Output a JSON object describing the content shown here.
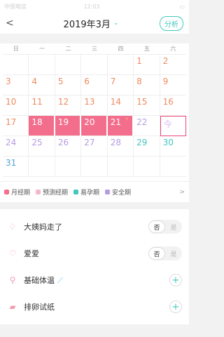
{
  "status": {
    "carrier": "中国电信",
    "time": "12:03"
  },
  "header": {
    "back_symbol": "<",
    "title": "2019年3月",
    "dropdown_symbol": "⌄",
    "analyze_label": "分析"
  },
  "weekdays": [
    "日",
    "一",
    "二",
    "三",
    "四",
    "五",
    "六"
  ],
  "calendar": {
    "cells": [
      {
        "day": "",
        "type": "empty"
      },
      {
        "day": "",
        "type": "empty"
      },
      {
        "day": "",
        "type": "empty"
      },
      {
        "day": "",
        "type": "empty"
      },
      {
        "day": "",
        "type": "empty"
      },
      {
        "day": "1",
        "type": "orange"
      },
      {
        "day": "2",
        "type": "orange"
      },
      {
        "day": "3",
        "type": "orange"
      },
      {
        "day": "4",
        "type": "orange"
      },
      {
        "day": "5",
        "type": "orange"
      },
      {
        "day": "6",
        "type": "orange"
      },
      {
        "day": "7",
        "type": "orange"
      },
      {
        "day": "8",
        "type": "orange"
      },
      {
        "day": "9",
        "type": "orange"
      },
      {
        "day": "10",
        "type": "orange"
      },
      {
        "day": "11",
        "type": "orange"
      },
      {
        "day": "12",
        "type": "orange"
      },
      {
        "day": "13",
        "type": "orange"
      },
      {
        "day": "14",
        "type": "orange"
      },
      {
        "day": "15",
        "type": "orange"
      },
      {
        "day": "16",
        "type": "orange"
      },
      {
        "day": "17",
        "type": "orange"
      },
      {
        "day": "18",
        "type": "period"
      },
      {
        "day": "19",
        "type": "period"
      },
      {
        "day": "20",
        "type": "period"
      },
      {
        "day": "21",
        "type": "period",
        "mark": "\""
      },
      {
        "day": "22",
        "type": "purple"
      },
      {
        "day": "今",
        "type": "today"
      },
      {
        "day": "24",
        "type": "purple"
      },
      {
        "day": "25",
        "type": "purple"
      },
      {
        "day": "26",
        "type": "purple"
      },
      {
        "day": "27",
        "type": "purple"
      },
      {
        "day": "28",
        "type": "purple"
      },
      {
        "day": "29",
        "type": "teal"
      },
      {
        "day": "30",
        "type": "teal"
      },
      {
        "day": "31",
        "type": "blue"
      },
      {
        "day": "",
        "type": "empty"
      },
      {
        "day": "",
        "type": "empty"
      },
      {
        "day": "",
        "type": "empty"
      },
      {
        "day": "",
        "type": "empty"
      },
      {
        "day": "",
        "type": "empty"
      },
      {
        "day": "",
        "type": "empty"
      }
    ]
  },
  "legend": {
    "items": [
      {
        "label": "月经期",
        "color": "#f36e8d"
      },
      {
        "label": "预测经期",
        "color": "#f5b8c7"
      },
      {
        "label": "易孕期",
        "color": "#43c6bd"
      },
      {
        "label": "安全期",
        "color": "#b79be1"
      }
    ],
    "more_symbol": ">"
  },
  "records": [
    {
      "label": "大姨妈走了",
      "icon": "drop-icon",
      "icon_char": "♢",
      "control": "toggle",
      "no": "否",
      "yes": "是"
    },
    {
      "label": "爱爱",
      "icon": "hearts-icon",
      "icon_char": "♡",
      "control": "toggle",
      "no": "否",
      "yes": "是"
    },
    {
      "label": "基础体温",
      "icon": "thermometer-icon",
      "icon_char": "⚲",
      "control": "plus",
      "plus": "+",
      "extra_icon": "chart-icon",
      "extra_char": "⟋"
    },
    {
      "label": "排卵试纸",
      "icon": "test-strip-icon",
      "icon_char": "▰",
      "control": "plus",
      "plus": "+"
    }
  ]
}
